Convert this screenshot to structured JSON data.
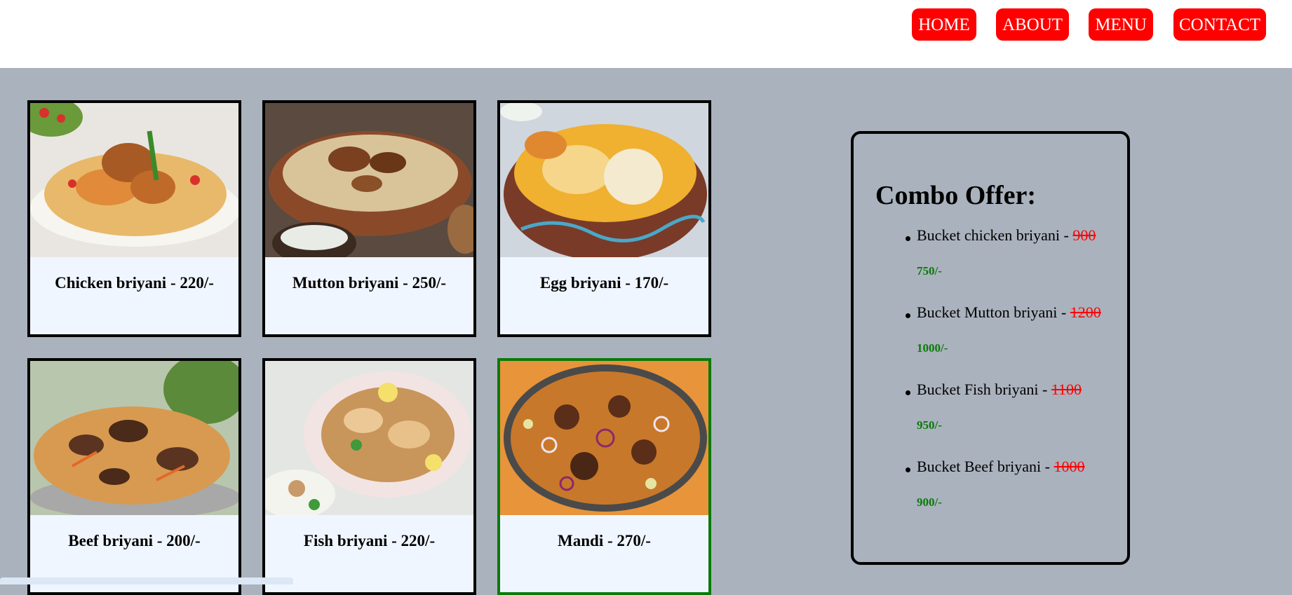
{
  "nav": {
    "home": "HOME",
    "about": "ABOUT",
    "menu": "MENU",
    "contact": "CONTACT",
    "button_color": "#ff0000"
  },
  "menu_items": [
    {
      "caption": "Chicken briyani - 220/-",
      "image": "chicken-biryani-photo"
    },
    {
      "caption": "Mutton briyani - 250/-",
      "image": "mutton-biryani-photo"
    },
    {
      "caption": "Egg briyani - 170/-",
      "image": "egg-biryani-photo"
    },
    {
      "caption": "Beef briyani - 200/-",
      "image": "beef-biryani-photo"
    },
    {
      "caption": "Fish briyani - 220/-",
      "image": "fish-biryani-photo"
    },
    {
      "caption": "Mandi - 270/-",
      "image": "mandi-photo",
      "selected": true
    }
  ],
  "combo": {
    "title": "Combo Offer:",
    "items": [
      {
        "name": "Bucket chicken briyani - ",
        "old_price": "900",
        "new_price": "750/-"
      },
      {
        "name": "Bucket Mutton briyani - ",
        "old_price": "1200",
        "new_price": "1000/-"
      },
      {
        "name": "Bucket Fish briyani - ",
        "old_price": "1100",
        "new_price": "950/-"
      },
      {
        "name": "Bucket Beef briyani - ",
        "old_price": "1000",
        "new_price": "900/-"
      }
    ],
    "old_price_color": "#ff0000",
    "new_price_color": "#0a7a0a"
  }
}
